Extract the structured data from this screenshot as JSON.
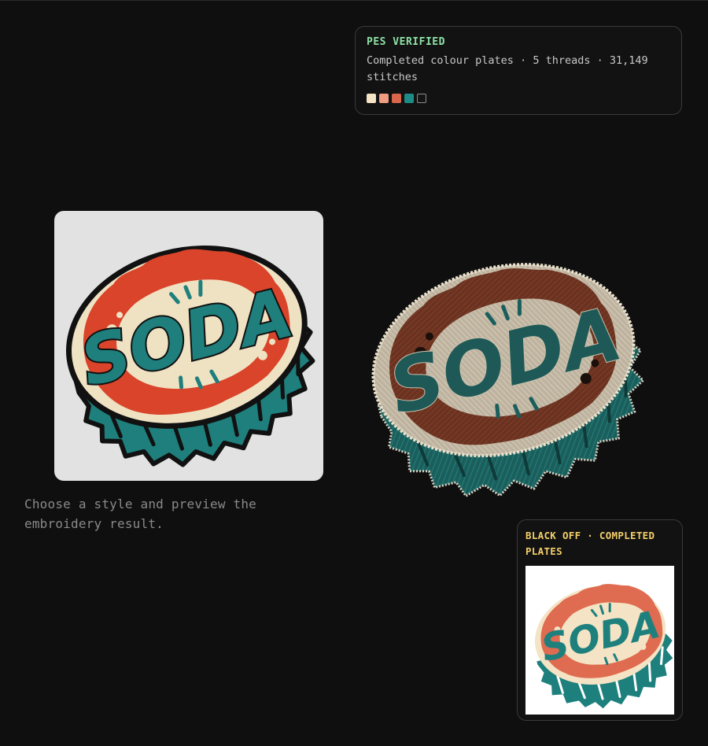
{
  "pes_card": {
    "title": "PES VERIFIED",
    "description": "Completed colour plates · 5 threads · 31,149 stitches",
    "swatches": [
      "#f4e3c4",
      "#ef9c7f",
      "#d9654b",
      "#1f8b87",
      "#141414"
    ]
  },
  "source": {
    "logo_text": "SODA"
  },
  "hint": {
    "text": "Choose a style and preview the embroidery result."
  },
  "preview": {
    "logo_text": "SODA"
  },
  "plates_card": {
    "title": "BLACK OFF · COMPLETED PLATES",
    "logo_text": "SODA"
  },
  "colors": {
    "background": "#0f0f0f",
    "verified_green": "#8ee0a6",
    "plates_yellow": "#f3cf6a",
    "cream": "#efe2c3",
    "red": "#d9442a",
    "teal": "#1e7f7c"
  }
}
